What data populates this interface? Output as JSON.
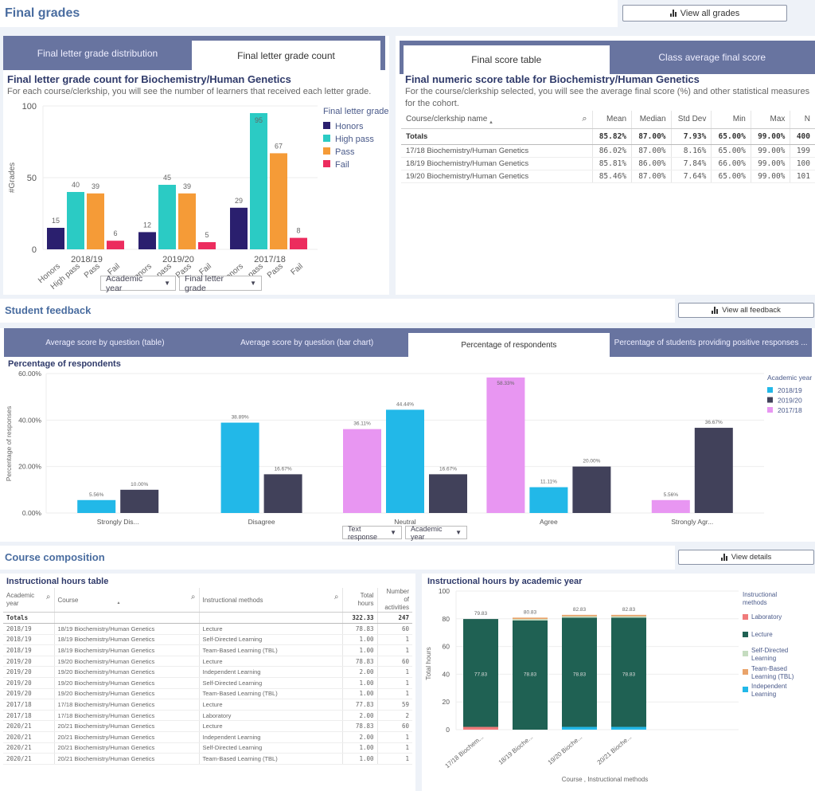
{
  "final_grades": {
    "section_title": "Final grades",
    "view_button": "View all grades",
    "left_panel": {
      "tabs": [
        {
          "label": "Final letter grade distribution",
          "active": false
        },
        {
          "label": "Final letter grade count",
          "active": true
        }
      ],
      "title": "Final letter grade count for Biochemistry/Human Genetics",
      "description": "For each course/clerkship, you will see the number of learners that received each letter grade.",
      "dropdowns": [
        "Academic year",
        "Final letter grade"
      ]
    },
    "right_panel": {
      "tabs": [
        {
          "label": "Final score table",
          "active": true
        },
        {
          "label": "Class average final score",
          "active": false
        }
      ],
      "title": "Final numeric score table for Biochemistry/Human Genetics",
      "description": "For the course/clerkship selected, you will see the average final score (%) and other statistical measures for the cohort.",
      "table": {
        "columns": [
          "Course/clerkship name",
          "Mean",
          "Median",
          "Std Dev",
          "Min",
          "Max",
          "N"
        ],
        "totals": [
          "Totals",
          "85.82%",
          "87.00%",
          "7.93%",
          "65.00%",
          "99.00%",
          "400"
        ],
        "rows": [
          [
            "17/18 Biochemistry/Human Genetics",
            "86.02%",
            "87.00%",
            "8.16%",
            "65.00%",
            "99.00%",
            "199"
          ],
          [
            "18/19 Biochemistry/Human Genetics",
            "85.81%",
            "86.00%",
            "7.84%",
            "66.00%",
            "99.00%",
            "100"
          ],
          [
            "19/20 Biochemistry/Human Genetics",
            "85.46%",
            "87.00%",
            "7.64%",
            "65.00%",
            "99.00%",
            "101"
          ]
        ]
      }
    }
  },
  "student_feedback": {
    "section_title": "Student feedback",
    "view_button": "View all feedback",
    "tabs": [
      {
        "label": "Average score by question (table)",
        "active": false
      },
      {
        "label": "Average score by question (bar chart)",
        "active": false
      },
      {
        "label": "Percentage of respondents",
        "active": true
      },
      {
        "label": "Percentage of students providing positive responses ...",
        "active": false
      }
    ],
    "title": "Percentage of respondents",
    "dropdowns": [
      "Text response",
      "Academic year"
    ]
  },
  "course_composition": {
    "section_title": "Course composition",
    "view_button": "View details",
    "table_title": "Instructional hours table",
    "table": {
      "columns": [
        "Academic year",
        "Course",
        "Instructional methods",
        "Total hours",
        "Number of activities"
      ],
      "totals": [
        "Totals",
        "",
        "",
        "322.33",
        "247"
      ],
      "rows": [
        [
          "2018/19",
          "18/19 Biochemistry/Human Genetics",
          "Lecture",
          "78.83",
          "60"
        ],
        [
          "2018/19",
          "18/19 Biochemistry/Human Genetics",
          "Self-Directed Learning",
          "1.00",
          "1"
        ],
        [
          "2018/19",
          "18/19 Biochemistry/Human Genetics",
          "Team-Based Learning (TBL)",
          "1.00",
          "1"
        ],
        [
          "2019/20",
          "19/20 Biochemistry/Human Genetics",
          "Lecture",
          "78.83",
          "60"
        ],
        [
          "2019/20",
          "19/20 Biochemistry/Human Genetics",
          "Independent Learning",
          "2.00",
          "1"
        ],
        [
          "2019/20",
          "19/20 Biochemistry/Human Genetics",
          "Self-Directed Learning",
          "1.00",
          "1"
        ],
        [
          "2019/20",
          "19/20 Biochemistry/Human Genetics",
          "Team-Based Learning (TBL)",
          "1.00",
          "1"
        ],
        [
          "2017/18",
          "17/18 Biochemistry/Human Genetics",
          "Lecture",
          "77.83",
          "59"
        ],
        [
          "2017/18",
          "17/18 Biochemistry/Human Genetics",
          "Laboratory",
          "2.00",
          "2"
        ],
        [
          "2020/21",
          "20/21 Biochemistry/Human Genetics",
          "Lecture",
          "78.83",
          "60"
        ],
        [
          "2020/21",
          "20/21 Biochemistry/Human Genetics",
          "Independent Learning",
          "2.00",
          "1"
        ],
        [
          "2020/21",
          "20/21 Biochemistry/Human Genetics",
          "Self-Directed Learning",
          "1.00",
          "1"
        ],
        [
          "2020/21",
          "20/21 Biochemistry/Human Genetics",
          "Team-Based Learning (TBL)",
          "1.00",
          "1"
        ]
      ]
    },
    "chart_title": "Instructional hours by academic year"
  },
  "chart_data": [
    {
      "id": "grade-count",
      "type": "bar",
      "title": "Final letter grade count for Biochemistry/Human Genetics",
      "ylabel": "#Grades",
      "ylim": [
        0,
        100
      ],
      "yticks": [
        0,
        50,
        100
      ],
      "groups": [
        "2018/19",
        "2019/20",
        "2017/18"
      ],
      "categories": [
        "Honors",
        "High pass",
        "Pass",
        "Fail"
      ],
      "legend_title": "Final letter grade",
      "legend_position": "right",
      "colors": {
        "Honors": "#2a1f6e",
        "High pass": "#2bcbc4",
        "Pass": "#f59b37",
        "Fail": "#ec2c5e"
      },
      "values": {
        "2018/19": [
          15,
          40,
          39,
          6
        ],
        "2019/20": [
          12,
          45,
          39,
          5
        ],
        "2017/18": [
          29,
          95,
          67,
          8
        ]
      }
    },
    {
      "id": "pct-respondents",
      "type": "bar",
      "title": "Percentage of respondents",
      "ylabel": "Percentage of responses",
      "ylim": [
        0,
        60
      ],
      "yticks": [
        "0.00%",
        "20.00%",
        "40.00%",
        "60.00%"
      ],
      "categories": [
        "Strongly Dis...",
        "Disagree",
        "Neutral",
        "Agree",
        "Strongly Agr..."
      ],
      "legend_title": "Academic year",
      "legend_position": "right",
      "series": [
        {
          "name": "2018/19",
          "color": "#22b8e8"
        },
        {
          "name": "2019/20",
          "color": "#41415a"
        },
        {
          "name": "2017/18",
          "color": "#e896f2"
        }
      ],
      "bars": [
        [
          {
            "series": "2018/19",
            "value": 5.56
          },
          {
            "series": "2019/20",
            "value": 10.0
          }
        ],
        [
          {
            "series": "2018/19",
            "value": 38.89
          },
          {
            "series": "2019/20",
            "value": 16.67
          }
        ],
        [
          {
            "series": "2017/18",
            "value": 36.11
          },
          {
            "series": "2018/19",
            "value": 44.44
          },
          {
            "series": "2019/20",
            "value": 16.67
          }
        ],
        [
          {
            "series": "2017/18",
            "value": 58.33
          },
          {
            "series": "2018/19",
            "value": 11.11
          },
          {
            "series": "2019/20",
            "value": 20.0
          }
        ],
        [
          {
            "series": "2017/18",
            "value": 5.56
          },
          {
            "series": "2019/20",
            "value": 36.67
          }
        ]
      ]
    },
    {
      "id": "hours-by-year",
      "type": "bar",
      "stacked": true,
      "title": "Instructional hours by academic year",
      "xlabel": "Course , Instructional methods",
      "ylabel": "Total hours",
      "ylim": [
        0,
        100
      ],
      "yticks": [
        0,
        20,
        40,
        60,
        80,
        100
      ],
      "categories": [
        "17/18 Biochem...",
        "18/19 Bioche...",
        "19/20 Bioche...",
        "20/21 Bioche..."
      ],
      "legend_title": "Instructional methods",
      "legend_position": "right",
      "series": [
        {
          "name": "Laboratory",
          "color": "#f07b7b",
          "values": [
            2,
            0,
            0,
            0
          ]
        },
        {
          "name": "Independent Learning",
          "color": "#22b8e8",
          "values": [
            0,
            0,
            2,
            2
          ]
        },
        {
          "name": "Lecture",
          "color": "#1f6153",
          "values": [
            77.83,
            78.83,
            78.83,
            78.83
          ]
        },
        {
          "name": "Self-Directed Learning",
          "color": "#c5dcc0",
          "values": [
            0,
            1,
            1,
            1
          ]
        },
        {
          "name": "Team-Based Learning (TBL)",
          "color": "#e9a36a",
          "values": [
            0,
            1,
            1,
            1
          ]
        }
      ],
      "legend_order": [
        "Laboratory",
        "Lecture",
        "Self-Directed Learning",
        "Team-Based Learning (TBL)",
        "Independent Learning"
      ],
      "totals": [
        79.83,
        80.83,
        82.83,
        82.83
      ],
      "lecture_labels": [
        "77.83",
        "78.83",
        "78.83",
        "78.83"
      ]
    }
  ]
}
